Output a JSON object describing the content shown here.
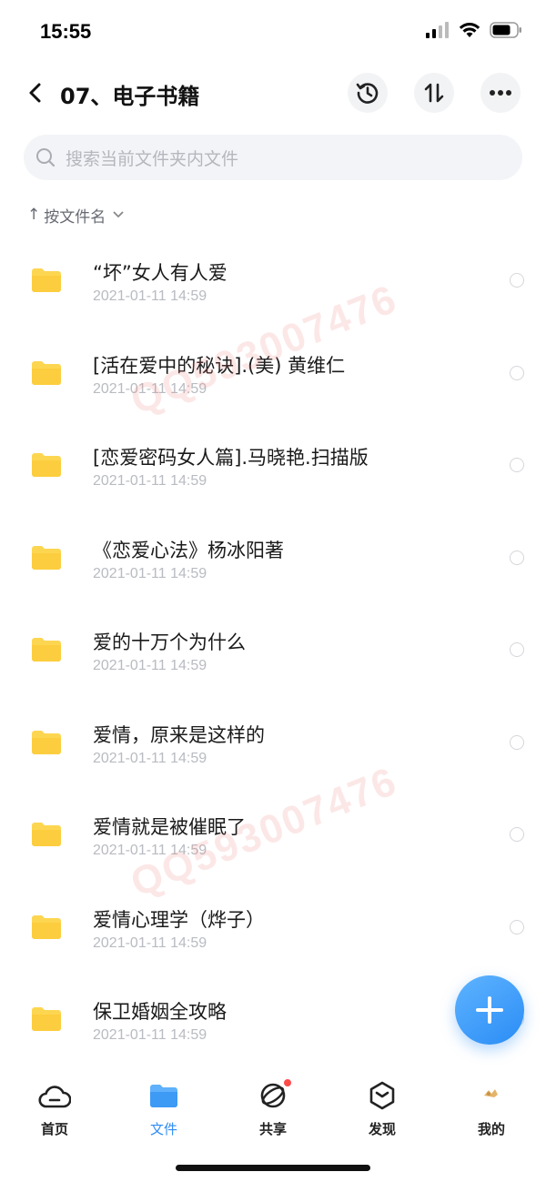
{
  "status": {
    "time": "15:55",
    "signal_icon": "cellular-signal-icon",
    "wifi_icon": "wifi-icon",
    "battery_icon": "battery-icon"
  },
  "nav": {
    "title": "07、电子书籍",
    "back_icon": "chevron-left-icon",
    "history_icon": "history-icon",
    "sort_icon": "sort-arrows-icon",
    "more_icon": "more-dots-icon"
  },
  "search": {
    "placeholder": "搜索当前文件夹内文件",
    "icon": "search-icon"
  },
  "sort": {
    "label": "按文件名",
    "arrow": "↑"
  },
  "files": [
    {
      "name": "“坏”女人有人爱",
      "date": "2021-01-11 14:59"
    },
    {
      "name": "[活在爱中的秘诀].(美) 黄维仁",
      "date": "2021-01-11 14:59"
    },
    {
      "name": "[恋爱密码女人篇].马晓艳.扫描版",
      "date": "2021-01-11 14:59"
    },
    {
      "name": "《恋爱心法》杨冰阳著",
      "date": "2021-01-11 14:59"
    },
    {
      "name": "爱的十万个为什么",
      "date": "2021-01-11 14:59"
    },
    {
      "name": "爱情，原来是这样的",
      "date": "2021-01-11 14:59"
    },
    {
      "name": "爱情就是被催眠了",
      "date": "2021-01-11 14:59"
    },
    {
      "name": "爱情心理学（烨子）",
      "date": "2021-01-11 14:59"
    },
    {
      "name": "保卫婚姻全攻略",
      "date": "2021-01-11 14:59"
    }
  ],
  "watermark": {
    "text": "QQ593007476"
  },
  "tabs": [
    {
      "label": "首页",
      "icon": "cloud-home-icon"
    },
    {
      "label": "文件",
      "icon": "folder-icon"
    },
    {
      "label": "共享",
      "icon": "share-orbit-icon"
    },
    {
      "label": "发现",
      "icon": "discover-cube-icon"
    },
    {
      "label": "我的",
      "icon": "profile-icon"
    }
  ],
  "colors": {
    "accent": "#2f8cf4",
    "folder": "#fdd651",
    "badge": "#ff4a4a"
  }
}
